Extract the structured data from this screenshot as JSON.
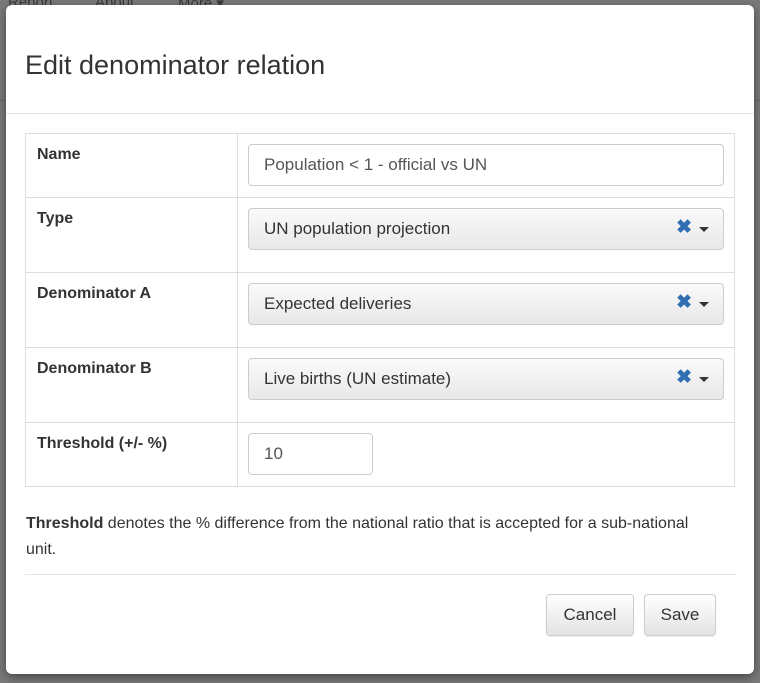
{
  "background": {
    "nav": [
      "Report",
      "About",
      "More ▾"
    ]
  },
  "modal": {
    "title": "Edit denominator relation",
    "fields": {
      "name": {
        "label": "Name",
        "value": "Population < 1 - official vs UN"
      },
      "type": {
        "label": "Type",
        "value": "UN population projection"
      },
      "denominator_a": {
        "label": "Denominator A",
        "value": "Expected deliveries"
      },
      "denominator_b": {
        "label": "Denominator B",
        "value": "Live births (UN estimate)"
      },
      "threshold": {
        "label": "Threshold (+/- %)",
        "value": "10"
      }
    },
    "help": {
      "bold": "Threshold",
      "text": " denotes the % difference from the national ratio that is accepted for a sub-national unit."
    },
    "buttons": {
      "cancel": "Cancel",
      "save": "Save"
    },
    "select_clear_glyph": "✖"
  },
  "colors": {
    "clear_icon": "#2f6fb2",
    "backdrop": "#7a7a7a"
  }
}
